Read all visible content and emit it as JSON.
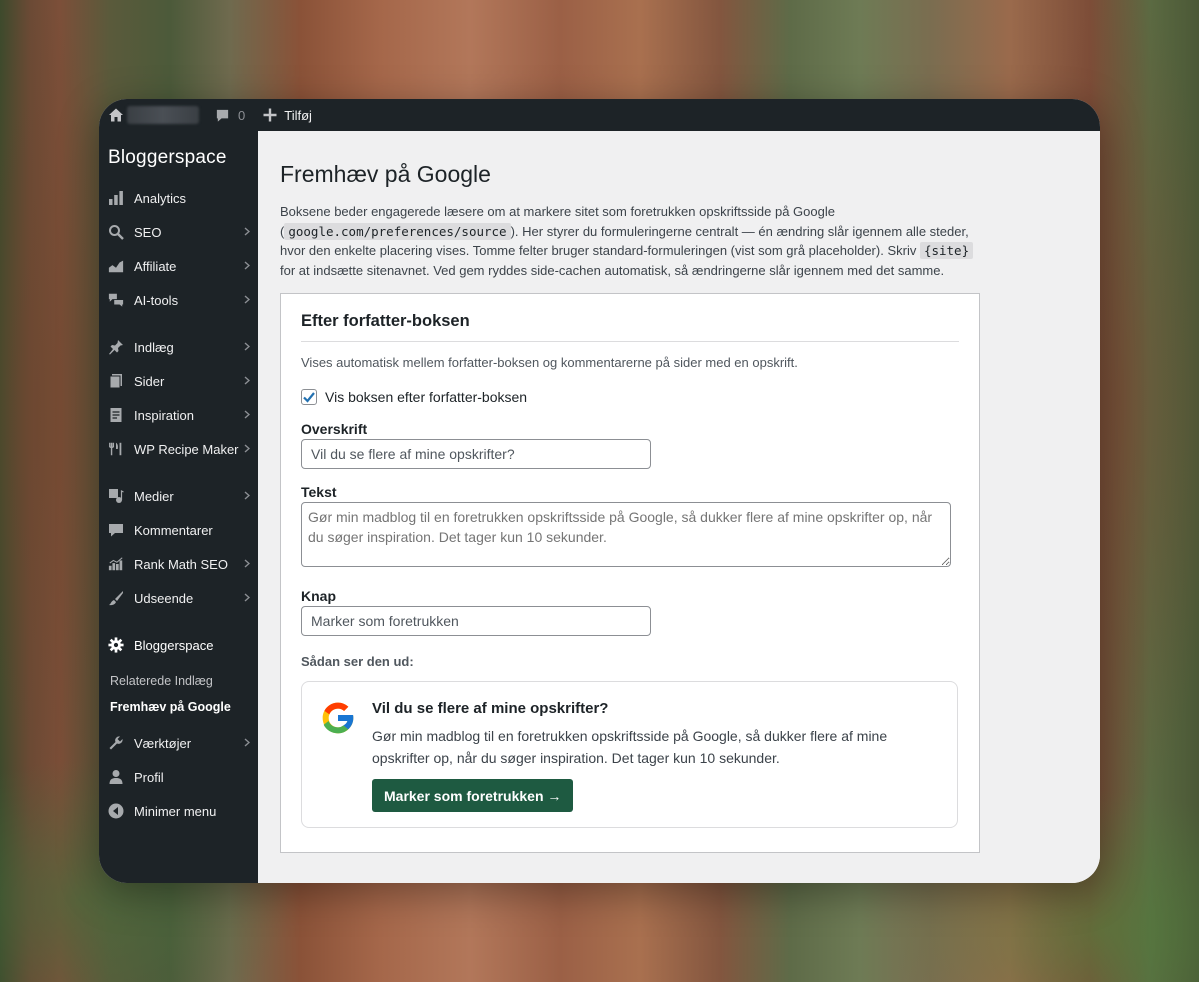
{
  "adminbar": {
    "comments_count": "0",
    "add_label": "Tilføj"
  },
  "sidebar": {
    "brand": "Bloggerspace",
    "items": [
      {
        "label": "Analytics",
        "icon": "bar-chart-icon"
      },
      {
        "label": "SEO",
        "icon": "search-icon"
      },
      {
        "label": "Affiliate",
        "icon": "area-chart-icon"
      },
      {
        "label": "AI-tools",
        "icon": "chat-bubbles-icon"
      },
      {
        "label": "Indlæg",
        "icon": "pin-icon"
      },
      {
        "label": "Sider",
        "icon": "pages-icon"
      },
      {
        "label": "Inspiration",
        "icon": "document-icon"
      },
      {
        "label": "WP Recipe Maker",
        "icon": "utensils-icon"
      },
      {
        "label": "Medier",
        "icon": "media-icon"
      },
      {
        "label": "Kommentarer",
        "icon": "comment-icon"
      },
      {
        "label": "Rank Math SEO",
        "icon": "rank-chart-icon"
      },
      {
        "label": "Udseende",
        "icon": "brush-icon"
      },
      {
        "label": "Bloggerspace",
        "icon": "gear-icon"
      },
      {
        "label": "Værktøjer",
        "icon": "wrench-icon"
      },
      {
        "label": "Profil",
        "icon": "user-icon"
      },
      {
        "label": "Minimer menu",
        "icon": "collapse-icon"
      }
    ],
    "submenu": [
      "Relaterede Indlæg",
      "Fremhæv på Google"
    ]
  },
  "main": {
    "title": "Fremhæv på Google",
    "intro_1": "Boksene beder engagerede læsere om at markere sitet som foretrukken opskriftsside på Google (",
    "intro_code_1": "google.com/preferences/source",
    "intro_2": "). Her styrer du formuleringerne centralt — én ændring slår igennem alle steder, hvor den enkelte placering vises. Tomme felter bruger standard-formuleringen (vist som grå placeholder). Skriv ",
    "intro_code_2": "{site}",
    "intro_3": " for at indsætte sitenavnet. Ved gem ryddes side-cachen automatisk, så ændringerne slår igennem med det samme.",
    "card": {
      "heading": "Efter forfatter-boksen",
      "description": "Vises automatisk mellem forfatter-boksen og kommentarerne på sider med en opskrift.",
      "checkbox_label": "Vis boksen efter forfatter-boksen",
      "checkbox_checked": true,
      "overskrift_label": "Overskrift",
      "overskrift_placeholder": "Vil du se flere af mine opskrifter?",
      "tekst_label": "Tekst",
      "tekst_placeholder": "Gør min madblog til en foretrukken opskriftsside på Google, så dukker flere af mine opskrifter op, når du søger inspiration. Det tager kun 10 sekunder.",
      "knap_label": "Knap",
      "knap_placeholder": "Marker som foretrukken",
      "preview_label": "Sådan ser den ud:",
      "preview": {
        "title": "Vil du se flere af mine opskrifter?",
        "text": "Gør min madblog til en foretrukken opskriftsside på Google, så dukker flere af mine opskrifter op, når du søger inspiration. Det tager kun 10 sekunder.",
        "button": "Marker som foretrukken →"
      }
    }
  },
  "colors": {
    "sidebar_bg": "#1d2327",
    "preview_button": "#1e5a41",
    "checkbox_accent": "#2271b1"
  }
}
